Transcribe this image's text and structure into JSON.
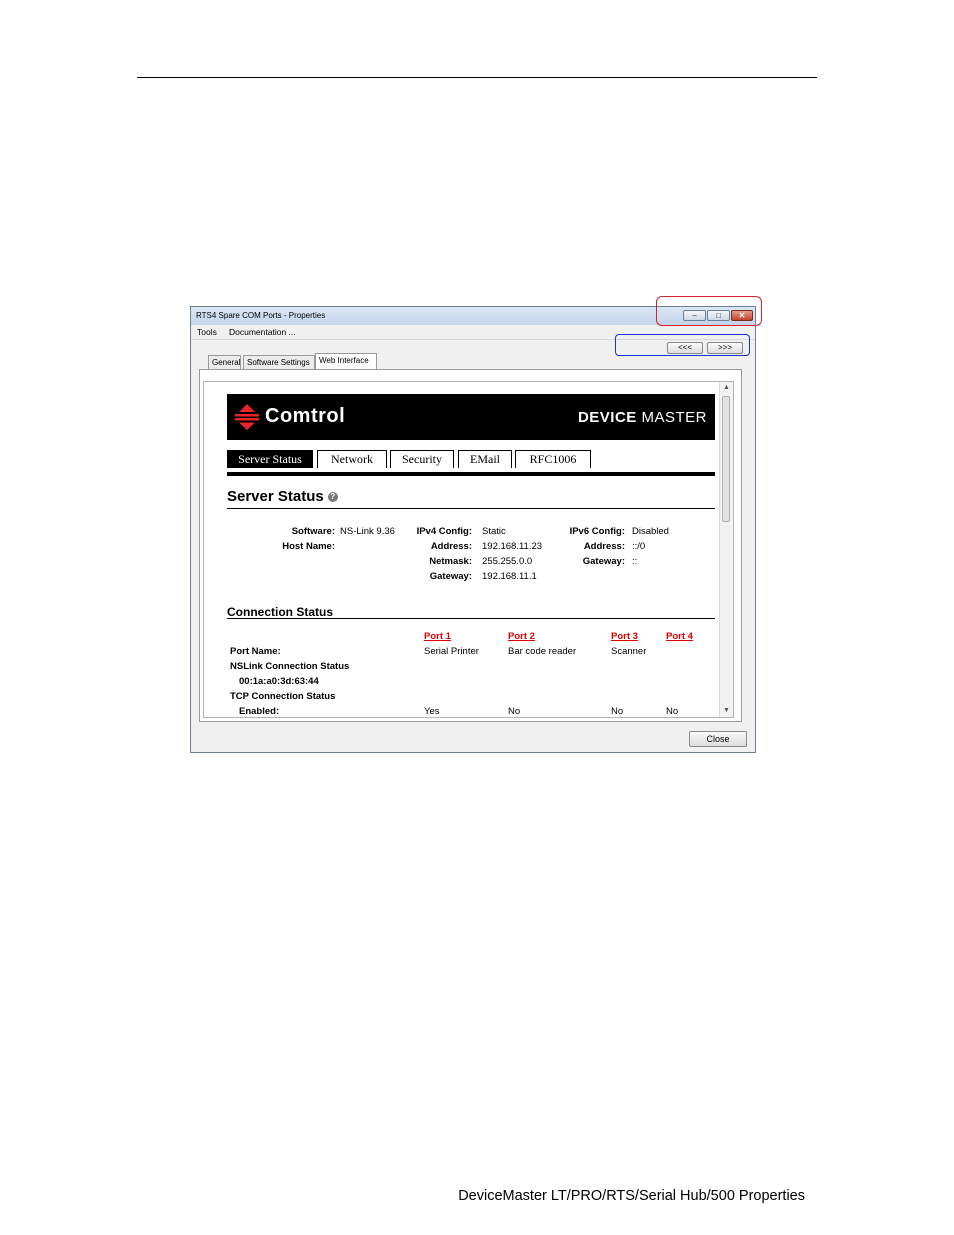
{
  "window": {
    "title": "RTS4 Spare COM Ports - Properties",
    "menu": [
      "Tools",
      "Documentation ..."
    ],
    "prev_label": "<<<",
    "next_label": ">>>",
    "tabs": [
      "General",
      "Software Settings",
      "Web Interface"
    ],
    "close_label": "Close"
  },
  "web": {
    "brand": "Comtrol",
    "product_bold": "DEVICE",
    "product_rest": "MASTER",
    "nav": [
      "Server Status",
      "Network",
      "Security",
      "EMail",
      "RFC1006"
    ],
    "server_status_heading": "Server Status",
    "server": {
      "software_label": "Software:",
      "software_value": "NS-Link 9.36",
      "host_label": "Host Name:",
      "ipv4_label": "IPv4 Config:",
      "ipv4_value": "Static",
      "address_label": "Address:",
      "address_value": "192.168.11.23",
      "netmask_label": "Netmask:",
      "netmask_value": "255.255.0.0",
      "gateway_label": "Gateway:",
      "gateway_value": "192.168.11.1",
      "ipv6_label": "IPv6 Config:",
      "ipv6_value": "Disabled",
      "ipv6_address_label": "Address:",
      "ipv6_address_value": "::/0",
      "ipv6_gateway_label": "Gateway:",
      "ipv6_gateway_value": "::"
    },
    "connection_heading": "Connection Status",
    "ports": [
      "Port 1",
      "Port 2",
      "Port 3",
      "Port 4"
    ],
    "port_name_label": "Port Name:",
    "port_names": [
      "Serial Printer",
      "Bar code reader",
      "Scanner",
      ""
    ],
    "nslink_label": "NSLink Connection Status",
    "mac": "00:1a:a0:3d:63:44",
    "tcp_label": "TCP Connection Status",
    "enabled_label": "Enabled:",
    "enabled_values": [
      "Yes",
      "No",
      "No",
      "No"
    ]
  },
  "footer": "DeviceMaster LT/PRO/RTS/Serial Hub/500 Properties",
  "colors": {
    "annotation_red": "#e0202a",
    "annotation_blue": "#2030d8",
    "port_link": "#e00000"
  }
}
